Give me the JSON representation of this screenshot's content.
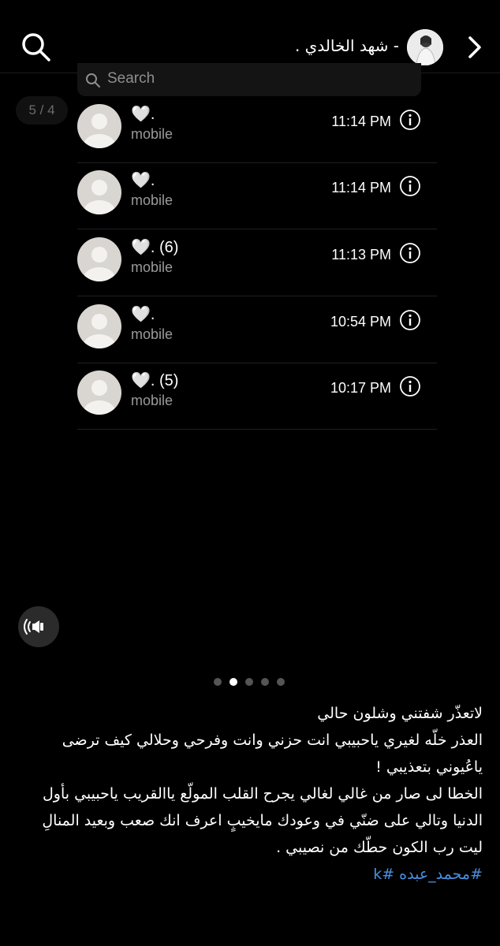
{
  "header": {
    "profile_name": "- شهد الخالدي .",
    "search_icon": "search-icon",
    "back_icon": "chevron-right-icon"
  },
  "screenshot": {
    "search_placeholder": "Search",
    "page_counter": "5 / 4",
    "calls": [
      {
        "name": "🤍.",
        "label": "mobile",
        "time": "11:14 PM"
      },
      {
        "name": "🤍.",
        "label": "mobile",
        "time": "11:14 PM"
      },
      {
        "name": "🤍. (6)",
        "label": "mobile",
        "time": "11:13 PM"
      },
      {
        "name": "🤍.",
        "label": "mobile",
        "time": "10:54 PM"
      },
      {
        "name": "🤍. (5)",
        "label": "mobile",
        "time": "10:17 PM"
      }
    ]
  },
  "carousel": {
    "count": 5,
    "active_index": 1
  },
  "caption": {
    "lines": [
      "لاتعذّر شفتني وشلون حالي",
      "العذر خلّه لغيري ياحبيبي انت حزني وانت وفرحي وحلالي كيف ترضى ياعُيوني بتعذيبي !",
      "الخطا لى صار من غالي لغالي يجرح القلب المولّع ياالقريب ياحبيبي بأول الدنيا وتالي على ضنّي في وعودك مايخيبٍ اعرف انك صعب وبعيد المنالِ",
      "ليت رب الكون حطّك من نصيبي ."
    ],
    "hashtags": "#محمد_عبده #k"
  },
  "colors": {
    "background": "#000000",
    "hashtag": "#4a8fe0",
    "muted": "#9a9a9a"
  }
}
